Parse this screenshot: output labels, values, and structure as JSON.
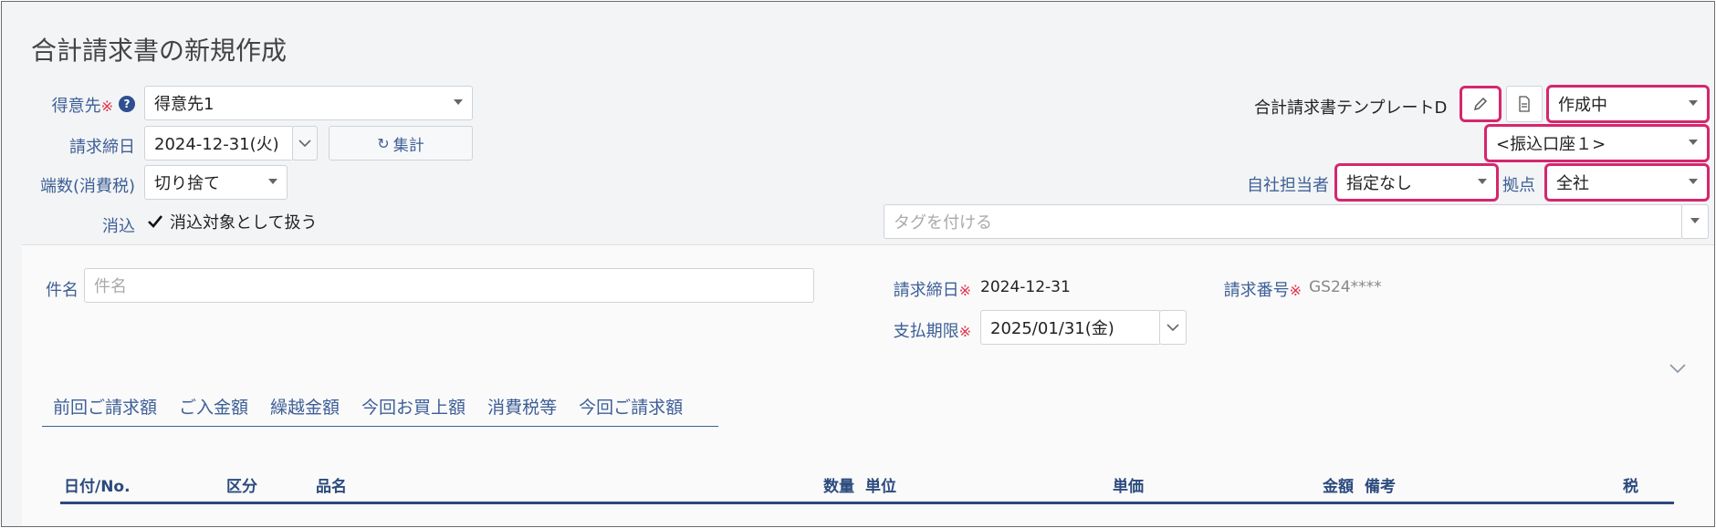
{
  "page": {
    "title": "合計請求書の新規作成"
  },
  "form": {
    "customer": {
      "label": "得意先",
      "required_mark": "※",
      "help": "?",
      "value": "得意先1"
    },
    "closing_date": {
      "label": "請求締日",
      "value": "2024-12-31(火)"
    },
    "aggregate_button": {
      "label": "集計",
      "icon": "refresh-icon"
    },
    "rounding": {
      "label": "端数(消費税)",
      "value": "切り捨て"
    },
    "reconcile": {
      "label": "消込",
      "checkbox_label": "消込対象として扱う",
      "checked": true
    }
  },
  "right": {
    "template_name": "合計請求書テンプレートD",
    "status_select": "作成中",
    "bank_select": "<振込口座１>",
    "staff": {
      "label": "自社担当者",
      "value": "指定なし"
    },
    "base": {
      "label": "拠点",
      "value": "全社"
    },
    "tags": {
      "placeholder": "タグを付ける"
    }
  },
  "detail": {
    "subject": {
      "label": "件名",
      "placeholder": "件名"
    },
    "closing": {
      "label": "請求締日",
      "required_mark": "※",
      "value": "2024-12-31"
    },
    "invoice_no": {
      "label": "請求番号",
      "required_mark": "※",
      "value": "GS24****"
    },
    "due": {
      "label": "支払期限",
      "required_mark": "※",
      "value": "2025/01/31(金)"
    }
  },
  "tabs": [
    "前回ご請求額",
    "ご入金額",
    "繰越金額",
    "今回お買上額",
    "消費税等",
    "今回ご請求額"
  ],
  "table": {
    "headers": {
      "date_no": "日付/No.",
      "category": "区分",
      "item": "品名",
      "qty": "数量",
      "unit": "単位",
      "unit_price": "単価",
      "amount": "金額",
      "note": "備考",
      "tax": "税"
    }
  },
  "colors": {
    "label_blue": "#3d5f97",
    "highlight": "#d6266e",
    "required": "#e0314a"
  }
}
